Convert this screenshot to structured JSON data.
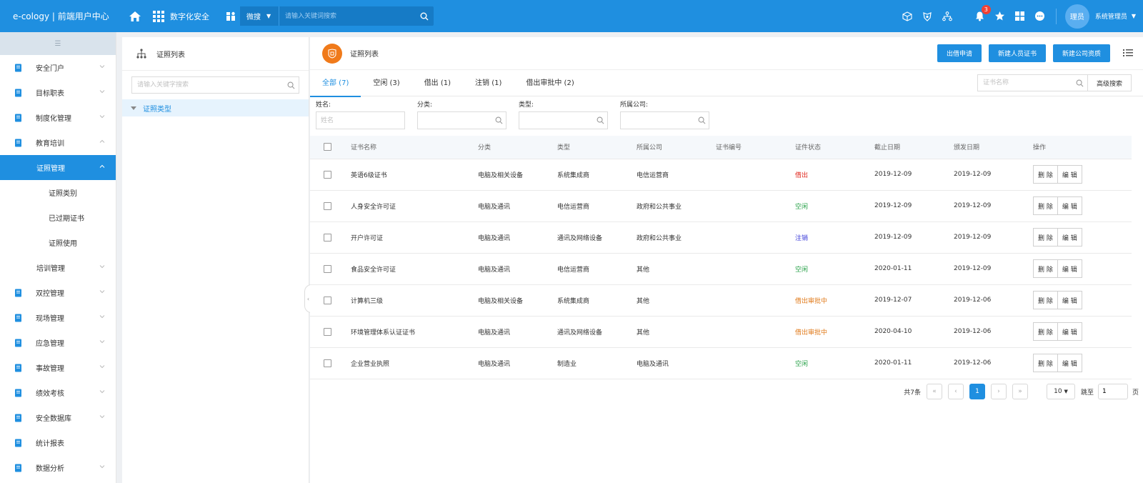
{
  "topbar": {
    "brand": "e-cology | 前端用户中心",
    "app_name": "数字化安全",
    "search_scope": "微搜",
    "search_placeholder": "请输入关键词搜索",
    "notification_count": "3",
    "avatar_text": "理员",
    "username": "系统管理员",
    "icons": [
      "home-icon",
      "app-grid-icon",
      "cube-icon",
      "shield-icon",
      "org-icon",
      "bell-icon",
      "star-icon",
      "tiles-icon",
      "chat-icon"
    ]
  },
  "sidebar": {
    "items": [
      {
        "label": "安全门户",
        "arrow": "down"
      },
      {
        "label": "目标职表",
        "arrow": "down"
      },
      {
        "label": "制度化管理",
        "arrow": "down"
      },
      {
        "label": "教育培训",
        "arrow": "up"
      },
      {
        "label": "证照管理",
        "arrow": "up",
        "active": true
      },
      {
        "label": "证照类别"
      },
      {
        "label": "已过期证书"
      },
      {
        "label": "证照使用"
      },
      {
        "label": "培训管理",
        "arrow": "down"
      },
      {
        "label": "双控管理",
        "arrow": "down"
      },
      {
        "label": "现场管理",
        "arrow": "down"
      },
      {
        "label": "应急管理",
        "arrow": "down"
      },
      {
        "label": "事故管理",
        "arrow": "down"
      },
      {
        "label": "绩效考核",
        "arrow": "down"
      },
      {
        "label": "安全数据库",
        "arrow": "down"
      },
      {
        "label": "统计报表"
      },
      {
        "label": "数据分析",
        "arrow": "down"
      }
    ]
  },
  "tree": {
    "title": "证照列表",
    "search_placeholder": "请输入关键字搜索",
    "node": "证照类型"
  },
  "main": {
    "title": "证照列表",
    "buttons": [
      "出借申请",
      "新建人员证书",
      "新建公司资质"
    ],
    "tabs": [
      "全部 (7)",
      "空闲 (3)",
      "借出 (1)",
      "注销 (1)",
      "借出审批中 (2)"
    ],
    "tab_search_placeholder": "证书名称",
    "advanced_search": "高级搜索",
    "filters": {
      "name_label": "姓名:",
      "name_placeholder": "姓名",
      "category_label": "分类:",
      "type_label": "类型:",
      "company_label": "所属公司:"
    },
    "columns": [
      "证书名称",
      "分类",
      "类型",
      "所属公司",
      "证书编号",
      "证件状态",
      "截止日期",
      "颁发日期",
      "操作"
    ],
    "rows": [
      {
        "name": "英语6级证书",
        "category": "电脑及相关设备",
        "type": "系统集成商",
        "company": "电信运营商",
        "number": "",
        "status": "借出",
        "status_class": "st-borrowed",
        "deadline": "2019-12-09",
        "issued": "2019-12-09"
      },
      {
        "name": "人身安全许可证",
        "category": "电脑及通讯",
        "type": "电信运营商",
        "company": "政府和公共事业",
        "number": "",
        "status": "空闲",
        "status_class": "st-idle",
        "deadline": "2019-12-09",
        "issued": "2019-12-09"
      },
      {
        "name": "开户许可证",
        "category": "电脑及通讯",
        "type": "通讯及网络设备",
        "company": "政府和公共事业",
        "number": "",
        "status": "注销",
        "status_class": "st-cancel",
        "deadline": "2019-12-09",
        "issued": "2019-12-09"
      },
      {
        "name": "食品安全许可证",
        "category": "电脑及通讯",
        "type": "电信运营商",
        "company": "其他",
        "number": "",
        "status": "空闲",
        "status_class": "st-idle",
        "deadline": "2020-01-11",
        "issued": "2019-12-09"
      },
      {
        "name": "计算机三级",
        "category": "电脑及相关设备",
        "type": "系统集成商",
        "company": "其他",
        "number": "",
        "status": "借出审批中",
        "status_class": "st-pending",
        "deadline": "2019-12-07",
        "issued": "2019-12-06"
      },
      {
        "name": "环境管理体系认证证书",
        "category": "电脑及通讯",
        "type": "通讯及网络设备",
        "company": "其他",
        "number": "",
        "status": "借出审批中",
        "status_class": "st-pending",
        "deadline": "2020-04-10",
        "issued": "2019-12-06"
      },
      {
        "name": "企业营业执照",
        "category": "电脑及通讯",
        "type": "制造业",
        "company": "电脑及通讯",
        "number": "",
        "status": "空闲",
        "status_class": "st-idle",
        "deadline": "2020-01-11",
        "issued": "2019-12-06"
      }
    ],
    "row_actions": [
      "删 除",
      "编 辑"
    ],
    "pager": {
      "total": "共7条",
      "current": "1",
      "page_size": "10",
      "jump_label": "跳至",
      "jump_value": "1",
      "suffix": "页"
    }
  },
  "colors": {
    "primary": "#1f8fe0",
    "borrowed": "#e0281e",
    "idle": "#27a148",
    "cancel": "#3a3ad8",
    "pending": "#e07a1a"
  }
}
